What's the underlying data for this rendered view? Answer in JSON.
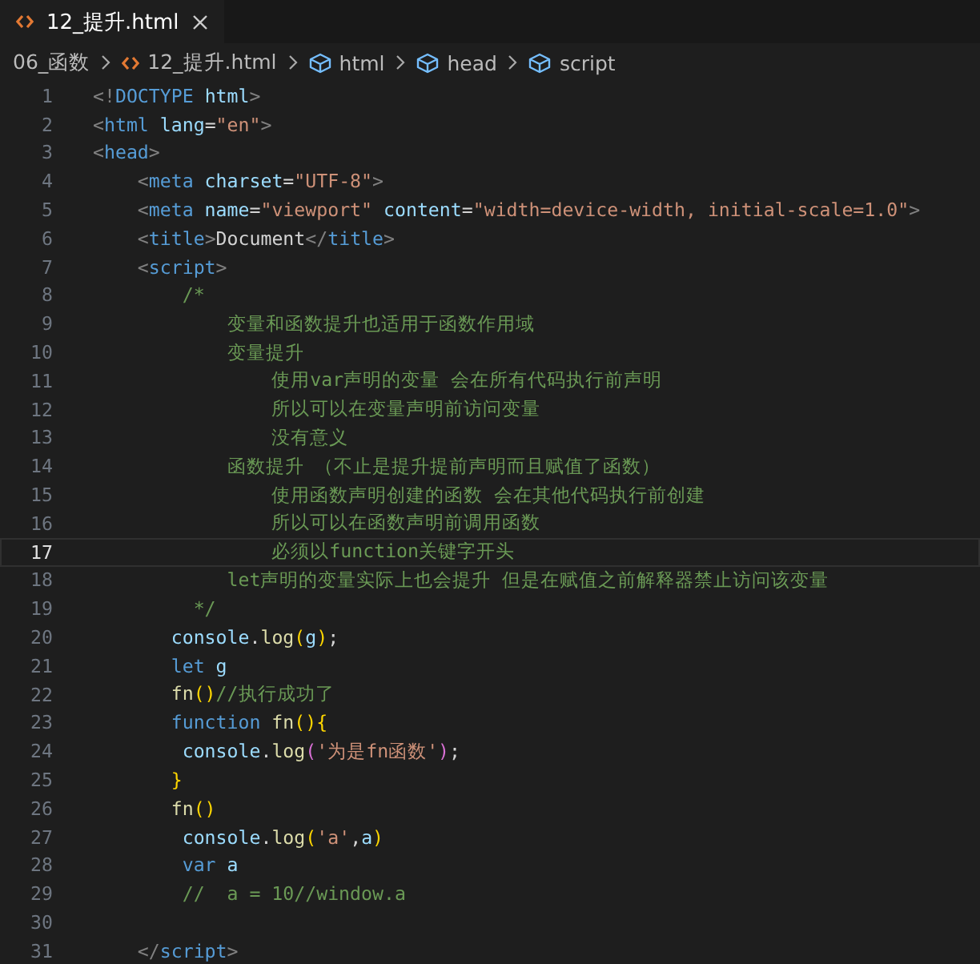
{
  "tab": {
    "label": "12_提升.html",
    "selected": true
  },
  "breadcrumb": [
    {
      "label": "06_函数",
      "kind": "folder"
    },
    {
      "label": "12_提升.html",
      "kind": "file"
    },
    {
      "label": "html",
      "kind": "symbol"
    },
    {
      "label": "head",
      "kind": "symbol"
    },
    {
      "label": "script",
      "kind": "symbol"
    }
  ],
  "lines": [
    {
      "number": "1",
      "active": false,
      "tokens": [
        {
          "kind": "b",
          "text": "<!"
        },
        {
          "kind": "tag",
          "text": "DOCTYPE"
        },
        {
          "kind": "attr",
          "text": " html"
        },
        {
          "kind": "b",
          "text": ">"
        }
      ]
    },
    {
      "number": "2",
      "active": false,
      "tokens": [
        {
          "kind": "b",
          "text": "<"
        },
        {
          "kind": "tag",
          "text": "html"
        },
        {
          "kind": "attr",
          "text": " lang"
        },
        {
          "kind": "text",
          "text": "="
        },
        {
          "kind": "str",
          "text": "\"en\""
        },
        {
          "kind": "b",
          "text": ">"
        }
      ]
    },
    {
      "number": "3",
      "active": false,
      "tokens": [
        {
          "kind": "b",
          "text": "<"
        },
        {
          "kind": "tag",
          "text": "head"
        },
        {
          "kind": "b",
          "text": ">"
        }
      ]
    },
    {
      "number": "4",
      "active": false,
      "tokens": [
        {
          "kind": "b",
          "text": "    <"
        },
        {
          "kind": "tag",
          "text": "meta"
        },
        {
          "kind": "attr",
          "text": " charset"
        },
        {
          "kind": "text",
          "text": "="
        },
        {
          "kind": "str",
          "text": "\"UTF-8\""
        },
        {
          "kind": "b",
          "text": ">"
        }
      ]
    },
    {
      "number": "5",
      "active": false,
      "tokens": [
        {
          "kind": "b",
          "text": "    <"
        },
        {
          "kind": "tag",
          "text": "meta"
        },
        {
          "kind": "attr",
          "text": " name"
        },
        {
          "kind": "text",
          "text": "="
        },
        {
          "kind": "str",
          "text": "\"viewport\""
        },
        {
          "kind": "attr",
          "text": " content"
        },
        {
          "kind": "text",
          "text": "="
        },
        {
          "kind": "str",
          "text": "\"width=device-width, initial-scale=1.0\""
        },
        {
          "kind": "b",
          "text": ">"
        }
      ]
    },
    {
      "number": "6",
      "active": false,
      "tokens": [
        {
          "kind": "b",
          "text": "    <"
        },
        {
          "kind": "tag",
          "text": "title"
        },
        {
          "kind": "b",
          "text": ">"
        },
        {
          "kind": "text",
          "text": "Document"
        },
        {
          "kind": "b",
          "text": "</"
        },
        {
          "kind": "tag",
          "text": "title"
        },
        {
          "kind": "b",
          "text": ">"
        }
      ]
    },
    {
      "number": "7",
      "active": false,
      "tokens": [
        {
          "kind": "b",
          "text": "    <"
        },
        {
          "kind": "tag",
          "text": "script"
        },
        {
          "kind": "b",
          "text": ">"
        }
      ]
    },
    {
      "number": "8",
      "active": false,
      "tokens": [
        {
          "kind": "com",
          "text": "        /*"
        }
      ]
    },
    {
      "number": "9",
      "active": false,
      "tokens": [
        {
          "kind": "com",
          "text": "            变量和函数提升也适用于函数作用域"
        }
      ]
    },
    {
      "number": "10",
      "active": false,
      "tokens": [
        {
          "kind": "com",
          "text": "            变量提升"
        }
      ]
    },
    {
      "number": "11",
      "active": false,
      "tokens": [
        {
          "kind": "com",
          "text": "                使用var声明的变量 会在所有代码执行前声明"
        }
      ]
    },
    {
      "number": "12",
      "active": false,
      "tokens": [
        {
          "kind": "com",
          "text": "                所以可以在变量声明前访问变量"
        }
      ]
    },
    {
      "number": "13",
      "active": false,
      "tokens": [
        {
          "kind": "com",
          "text": "                没有意义"
        }
      ]
    },
    {
      "number": "14",
      "active": false,
      "tokens": [
        {
          "kind": "com",
          "text": "            函数提升 （不止是提升提前声明而且赋值了函数）"
        }
      ]
    },
    {
      "number": "15",
      "active": false,
      "tokens": [
        {
          "kind": "com",
          "text": "                使用函数声明创建的函数 会在其他代码执行前创建"
        }
      ]
    },
    {
      "number": "16",
      "active": false,
      "tokens": [
        {
          "kind": "com",
          "text": "                所以可以在函数声明前调用函数"
        }
      ]
    },
    {
      "number": "17",
      "active": true,
      "tokens": [
        {
          "kind": "com",
          "text": "                必须以function关键字开头"
        }
      ]
    },
    {
      "number": "18",
      "active": false,
      "tokens": [
        {
          "kind": "com",
          "text": "            let声明的变量实际上也会提升 但是在赋值之前解释器禁止访问该变量"
        }
      ]
    },
    {
      "number": "19",
      "active": false,
      "tokens": [
        {
          "kind": "com",
          "text": "         */"
        }
      ]
    },
    {
      "number": "20",
      "active": false,
      "tokens": [
        {
          "kind": "var",
          "text": "       console"
        },
        {
          "kind": "text",
          "text": "."
        },
        {
          "kind": "fn",
          "text": "log"
        },
        {
          "kind": "p",
          "text": "("
        },
        {
          "kind": "var",
          "text": "g"
        },
        {
          "kind": "p",
          "text": ")"
        },
        {
          "kind": "text",
          "text": ";"
        }
      ]
    },
    {
      "number": "21",
      "active": false,
      "tokens": [
        {
          "kind": "kw",
          "text": "       let"
        },
        {
          "kind": "var",
          "text": " g"
        }
      ]
    },
    {
      "number": "22",
      "active": false,
      "tokens": [
        {
          "kind": "fn",
          "text": "       fn"
        },
        {
          "kind": "p",
          "text": "()"
        },
        {
          "kind": "com",
          "text": "//执行成功了"
        }
      ]
    },
    {
      "number": "23",
      "active": false,
      "tokens": [
        {
          "kind": "kw",
          "text": "       function"
        },
        {
          "kind": "fn",
          "text": " fn"
        },
        {
          "kind": "p",
          "text": "(){"
        }
      ]
    },
    {
      "number": "24",
      "active": false,
      "tokens": [
        {
          "kind": "var",
          "text": "        console"
        },
        {
          "kind": "text",
          "text": "."
        },
        {
          "kind": "fn",
          "text": "log"
        },
        {
          "kind": "p2",
          "text": "("
        },
        {
          "kind": "str",
          "text": "'为是fn函数'"
        },
        {
          "kind": "p2",
          "text": ")"
        },
        {
          "kind": "text",
          "text": ";"
        }
      ]
    },
    {
      "number": "25",
      "active": false,
      "tokens": [
        {
          "kind": "p",
          "text": "       }"
        }
      ]
    },
    {
      "number": "26",
      "active": false,
      "tokens": [
        {
          "kind": "fn",
          "text": "       fn"
        },
        {
          "kind": "p",
          "text": "()"
        }
      ]
    },
    {
      "number": "27",
      "active": false,
      "tokens": [
        {
          "kind": "var",
          "text": "        console"
        },
        {
          "kind": "text",
          "text": "."
        },
        {
          "kind": "fn",
          "text": "log"
        },
        {
          "kind": "p",
          "text": "("
        },
        {
          "kind": "str",
          "text": "'a'"
        },
        {
          "kind": "text",
          "text": ","
        },
        {
          "kind": "var",
          "text": "a"
        },
        {
          "kind": "p",
          "text": ")"
        }
      ]
    },
    {
      "number": "28",
      "active": false,
      "tokens": [
        {
          "kind": "kw",
          "text": "        var"
        },
        {
          "kind": "var",
          "text": " a"
        }
      ]
    },
    {
      "number": "29",
      "active": false,
      "tokens": [
        {
          "kind": "com",
          "text": "        //  a = 10//window.a"
        }
      ]
    },
    {
      "number": "30",
      "active": false
    },
    {
      "number": "31",
      "active": false,
      "tokens": [
        {
          "kind": "b",
          "text": "    </"
        },
        {
          "kind": "tag",
          "text": "script"
        },
        {
          "kind": "b",
          "text": ">"
        }
      ]
    }
  ]
}
